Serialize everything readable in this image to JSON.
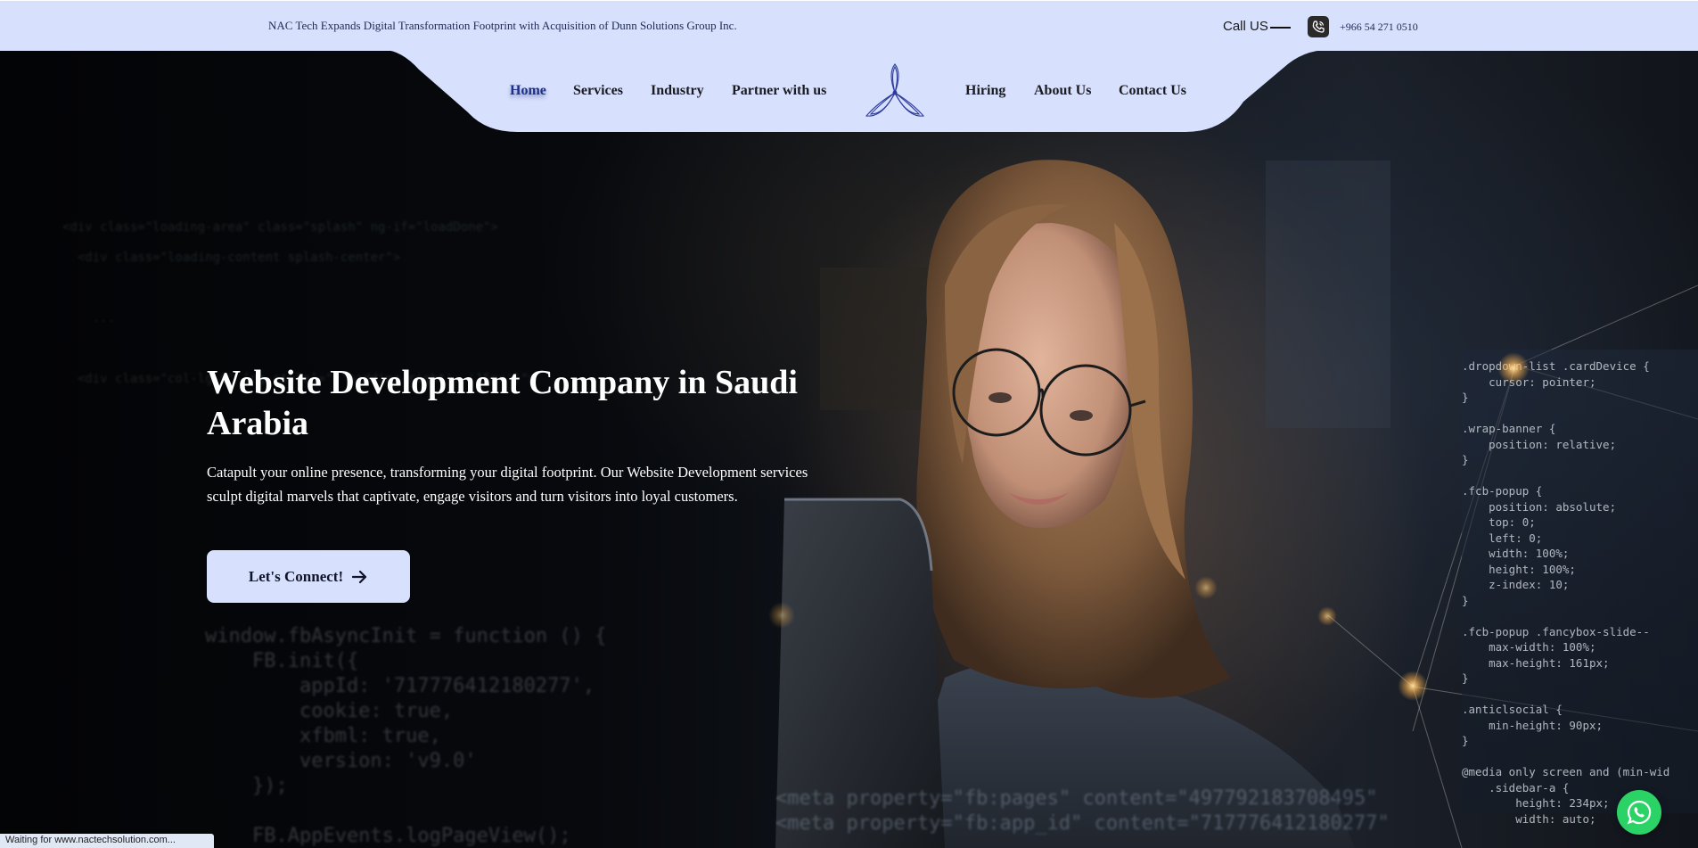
{
  "topbar": {
    "news": "NAC Tech Expands Digital Transformation Footprint with Acquisition of Dunn Solutions Group Inc.",
    "call_label": "Call US",
    "phone": "+966 54 271 0510",
    "phone_icon": "phone-icon"
  },
  "nav": {
    "left_items": [
      {
        "label": "Home",
        "active": true
      },
      {
        "label": "Services"
      },
      {
        "label": "Industry"
      },
      {
        "label": "Partner with us"
      }
    ],
    "right_items": [
      {
        "label": "Hiring"
      },
      {
        "label": "About Us"
      },
      {
        "label": "Contact Us"
      }
    ],
    "logo_icon": "propeller-logo-icon"
  },
  "hero": {
    "title": "Website Development Company in Saudi Arabia",
    "description": "Catapult your online presence, transforming your digital footprint. Our Website Development services sculpt digital marvels that captivate, engage visitors and turn visitors into loyal customers.",
    "cta_label": "Let's Connect!",
    "cta_icon": "arrow-right-icon"
  },
  "background_code": {
    "left_top": [
      "<div class=\"loading-area\" class=\"splash\" ng-if=\"loadDone\">",
      "  <div class=\"loading-content splash-center\">",
      "",
      "    ...",
      "",
      "  <div class=\"col-lg-6\" [ng-style]=\"{'padding-right': '15px'}\">",
      "",
      "",
      "",
      "",
      "",
      ""
    ],
    "left_bottom": [
      "window.fbAsyncInit = function () {",
      "    FB.init({",
      "        appId: '717776412180277',",
      "        cookie: true,",
      "        xfbml: true,",
      "        version: 'v9.0'",
      "    });",
      "",
      "    FB.AppEvents.logPageView();"
    ],
    "bottom": [
      "<meta property=\"fb:pages\" content=\"497792183708495\"",
      "<meta property=\"fb:app_id\" content=\"717776412180277\""
    ],
    "right": [
      ".dropdown-list .cardDevice {",
      "    cursor: pointer;",
      "}",
      "",
      ".wrap-banner {",
      "    position: relative;",
      "}",
      "",
      ".fcb-popup {",
      "    position: absolute;",
      "    top: 0;",
      "    left: 0;",
      "    width: 100%;",
      "    height: 100%;",
      "    z-index: 10;",
      "}",
      "",
      ".fcb-popup .fancybox-slide--",
      "    max-width: 100%;",
      "    max-height: 161px;",
      "}",
      "",
      ".anticlsocial {",
      "    min-height: 90px;",
      "}",
      "",
      "@media only screen and (min-wid",
      "    .sidebar-a {",
      "        height: 234px;",
      "        width: auto;"
    ]
  },
  "status_bar": {
    "text": "Waiting for www.nactechsolution.com..."
  },
  "whatsapp": {
    "icon": "whatsapp-icon"
  },
  "colors": {
    "topbar_bg": "#d7e0fd",
    "accent": "#1e2f86",
    "cta_bg": "#d7e0fd",
    "whatsapp_green": "#2bd366"
  }
}
